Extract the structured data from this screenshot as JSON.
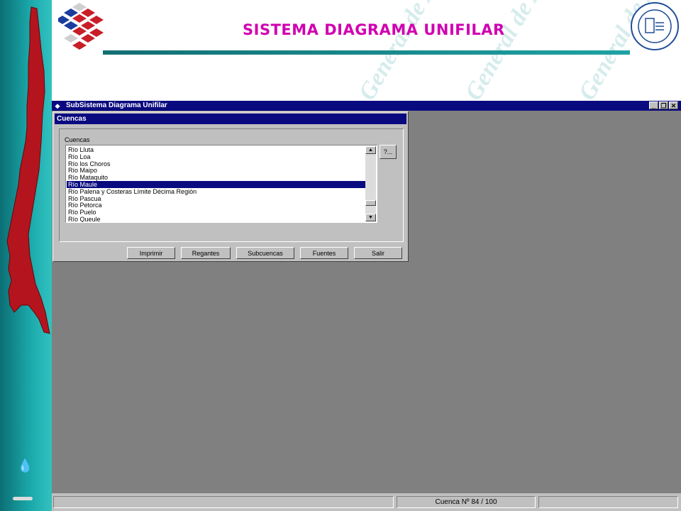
{
  "slide": {
    "title": "SISTEMA DIAGRAMA UNIFILAR",
    "watermark_text": "Dirección General de Aguas DGA",
    "colors": {
      "title": "#d000b0",
      "teal": "#1aa6a8",
      "map_red": "#b4141e"
    }
  },
  "window": {
    "title": "SubSistema Diagrama Unifilar",
    "controls": [
      "minimize",
      "restore",
      "close"
    ]
  },
  "dialog": {
    "title": "Cuencas",
    "group_label": "Cuencas",
    "list_items": [
      "Río Lluta",
      "Río Loa",
      "Río los Choros",
      "Río Maipo",
      "Río Mataquito",
      "Río Maule",
      "Río Palena y Costeras Límite Décima Región",
      "Río Pascua",
      "Río Petorca",
      "Río Puelo",
      "Río Queule"
    ],
    "selected_index": 5,
    "help_button": "?...",
    "buttons": {
      "print": "Imprimir",
      "irrigators": "Regantes",
      "subbasins": "Subcuencas",
      "sources": "Fuentes",
      "exit": "Salir"
    }
  },
  "status": {
    "record": "Cuenca Nº 84 / 100"
  }
}
